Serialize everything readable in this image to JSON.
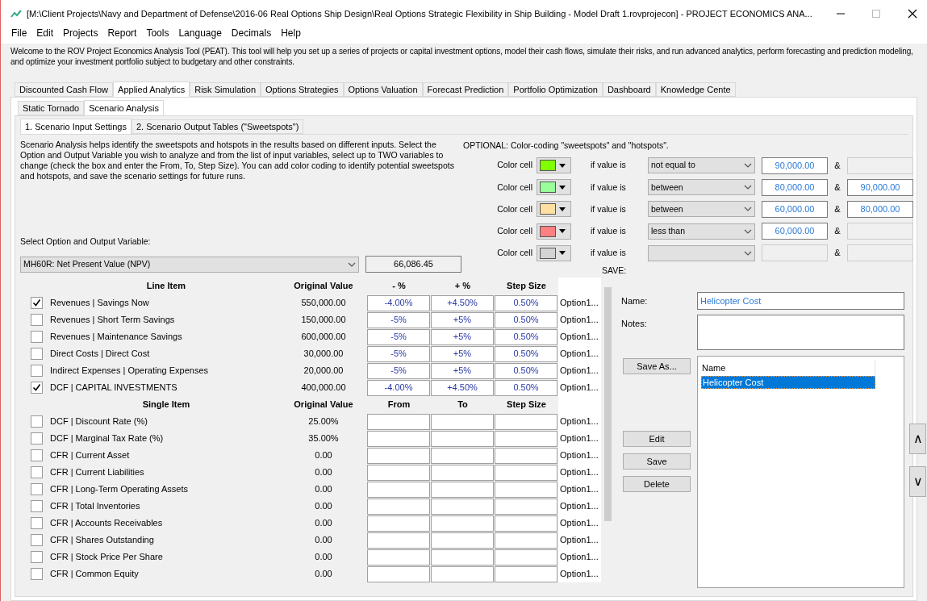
{
  "window": {
    "title": "[M:\\Client Projects\\Navy and Department of Defense\\2016-06 Real Options Ship Design\\Real Options Strategic Flexibility in Ship Building - Model Draft 1.rovprojecon] - PROJECT ECONOMICS ANA..."
  },
  "menu": [
    "File",
    "Edit",
    "Projects",
    "Report",
    "Tools",
    "Language",
    "Decimals",
    "Help"
  ],
  "welcome": "Welcome to the ROV Project Economics Analysis Tool (PEAT). This tool will help you set up a series of projects or capital investment options, model their cash flows, simulate their risks, and run advanced analytics, perform forecasting and prediction modeling, and optimize your investment portfolio subject to budgetary and other constraints.",
  "tabs": [
    {
      "label": "Discounted Cash Flow",
      "selected": false
    },
    {
      "label": "Applied Analytics",
      "selected": true
    },
    {
      "label": "Risk Simulation",
      "selected": false
    },
    {
      "label": "Options Strategies",
      "selected": false
    },
    {
      "label": "Options Valuation",
      "selected": false
    },
    {
      "label": "Forecast Prediction",
      "selected": false
    },
    {
      "label": "Portfolio Optimization",
      "selected": false
    },
    {
      "label": "Dashboard",
      "selected": false
    },
    {
      "label": "Knowledge Cente",
      "selected": false
    }
  ],
  "sub_tabs": [
    {
      "label": "Static Tornado",
      "selected": false
    },
    {
      "label": "Scenario Analysis",
      "selected": true
    }
  ],
  "inner_tabs": [
    {
      "label": "1. Scenario Input Settings",
      "selected": true
    },
    {
      "label": "2. Scenario Output Tables (\"Sweetspots\")",
      "selected": false
    }
  ],
  "description": "Scenario Analysis helps identify the sweetspots and hotspots in the results based on different inputs. Select the Option and Output Variable you wish to analyze and from the list of input variables, select up to TWO variables to change (check the box and enter the From, To, Step Size). You can add color coding to identify potential sweetspots and hotspots, and save the scenario settings for future runs.",
  "select_label": "Select Option and Output Variable:",
  "output_variable": "MH60R: Net Present Value (NPV)",
  "output_value": "66,086.45",
  "optional_label": "OPTIONAL: Color-coding \"sweetspots\" and \"hotspots\".",
  "color_rules": [
    {
      "label": "Color cell",
      "color": "#80ff00",
      "condition_label": "if value is",
      "condition": "not equal to",
      "value1": "90,000.00",
      "amp": "&"
    },
    {
      "label": "Color cell",
      "color": "#99ff99",
      "condition_label": "if value is",
      "condition": "between",
      "value1": "80,000.00",
      "amp": "&",
      "value2": "90,000.00"
    },
    {
      "label": "Color cell",
      "color": "#ffe0a0",
      "condition_label": "if value is",
      "condition": "between",
      "value1": "60,000.00",
      "amp": "&",
      "value2": "80,000.00"
    },
    {
      "label": "Color cell",
      "color": "#ff8080",
      "condition_label": "if value is",
      "condition": "less than",
      "value1": "60,000.00",
      "amp": "&"
    },
    {
      "label": "Color cell",
      "color": "#d4d4d4",
      "condition_label": "if value is",
      "amp": "&"
    }
  ],
  "save_label": "SAVE:",
  "table_sections": [
    {
      "columns": [
        "Line Item",
        "Original Value",
        "- %",
        "+ %",
        "Step Size"
      ],
      "rows": [
        {
          "checked": true,
          "item": "Revenues | Savings Now",
          "original": "550,000.00",
          "c1": "-4.00%",
          "c2": "+4.50%",
          "c3": "0.50%",
          "option": "Option1..."
        },
        {
          "checked": false,
          "item": "Revenues | Short Term Savings",
          "original": "150,000.00",
          "c1": "-5%",
          "c2": "+5%",
          "c3": "0.50%",
          "option": "Option1..."
        },
        {
          "checked": false,
          "item": "Revenues | Maintenance Savings",
          "original": "600,000.00",
          "c1": "-5%",
          "c2": "+5%",
          "c3": "0.50%",
          "option": "Option1..."
        },
        {
          "checked": false,
          "item": "Direct Costs | Direct Cost",
          "original": "30,000.00",
          "c1": "-5%",
          "c2": "+5%",
          "c3": "0.50%",
          "option": "Option1..."
        },
        {
          "checked": false,
          "item": "Indirect Expenses | Operating Expenses",
          "original": "20,000.00",
          "c1": "-5%",
          "c2": "+5%",
          "c3": "0.50%",
          "option": "Option1..."
        },
        {
          "checked": true,
          "item": "DCF | CAPITAL INVESTMENTS",
          "original": "400,000.00",
          "c1": "-4.00%",
          "c2": "+4.50%",
          "c3": "0.50%",
          "option": "Option1..."
        }
      ]
    },
    {
      "columns": [
        "Single Item",
        "Original Value",
        "From",
        "To",
        "Step Size"
      ],
      "rows": [
        {
          "checked": false,
          "item": "DCF | Discount Rate (%)",
          "original": "25.00%",
          "option": "Option1..."
        },
        {
          "checked": false,
          "item": "DCF | Marginal Tax Rate (%)",
          "original": "35.00%",
          "option": "Option1..."
        },
        {
          "checked": false,
          "item": "CFR | Current Asset",
          "original": "0.00",
          "option": "Option1..."
        },
        {
          "checked": false,
          "item": "CFR | Current Liabilities",
          "original": "0.00",
          "option": "Option1..."
        },
        {
          "checked": false,
          "item": "CFR | Long-Term Operating Assets",
          "original": "0.00",
          "option": "Option1..."
        },
        {
          "checked": false,
          "item": "CFR | Total Inventories",
          "original": "0.00",
          "option": "Option1..."
        },
        {
          "checked": false,
          "item": "CFR | Accounts Receivables",
          "original": "0.00",
          "option": "Option1..."
        },
        {
          "checked": false,
          "item": "CFR | Shares Outstanding",
          "original": "0.00",
          "option": "Option1..."
        },
        {
          "checked": false,
          "item": "CFR | Stock Price Per Share",
          "original": "0.00",
          "option": "Option1..."
        },
        {
          "checked": false,
          "item": "CFR | Common Equity",
          "original": "0.00",
          "option": "Option1..."
        }
      ]
    }
  ],
  "save_panel": {
    "name_label": "Name:",
    "name_value": "Helicopter Cost",
    "notes_label": "Notes:",
    "buttons": [
      "Save As...",
      "Edit",
      "Save",
      "Delete"
    ],
    "list_header": "Name",
    "list_items": [
      {
        "label": "Helicopter Cost",
        "selected": true
      }
    ],
    "move_up": "∧",
    "move_down": "∨"
  }
}
